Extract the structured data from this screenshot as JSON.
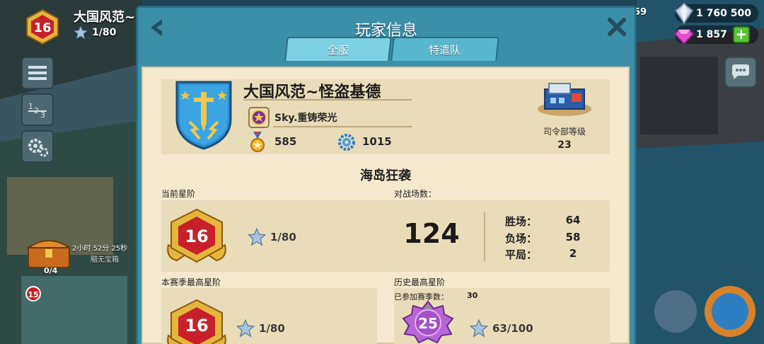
{
  "hud": {
    "player_name": "大国风范~",
    "rank_level": "16",
    "stars": "1/80",
    "partial_number": "59",
    "diamonds": "1 760 500",
    "gems": "1 857",
    "plus": "+",
    "notification_count": "15",
    "chest_timer": "2小时 52分 25秒",
    "chest_label": "黯无宝箱",
    "chest_progress": "0/4"
  },
  "modal": {
    "title": "玩家信息",
    "tabs": [
      {
        "label": "全服"
      },
      {
        "label": "特遣队"
      }
    ]
  },
  "profile": {
    "name": "大国风范~怪盗基德",
    "team": "Sky.重铸荣光",
    "medals": "585",
    "intel": "1015",
    "hq_label": "司令部等级",
    "hq_level": "23"
  },
  "warfare": {
    "section_title": "海岛狂袭",
    "current_rank_label": "当前星阶",
    "current_rank": "16",
    "current_stars": "1/80",
    "battles_label": "对战场数：",
    "battles_total": "124",
    "wins_label": "胜场：",
    "wins": "64",
    "losses_label": "负场：",
    "losses": "58",
    "draws_label": "平局：",
    "draws": "2",
    "season_best_label": "本赛季最高星阶",
    "season_best_rank": "16",
    "season_best_stars": "1/80",
    "all_time_label": "历史最高星阶",
    "seasons_played_label": "已参加赛季数：",
    "seasons_played": "30",
    "all_time_rank": "25",
    "all_time_stars": "63/100"
  },
  "colors": {
    "modal_teal": "#3c8fa8",
    "paper": "#f4e9cf",
    "panel": "#e9dcb9",
    "badge_red": "#c8202a",
    "badge_gold": "#e6b63c",
    "purple_badge": "#a54fc9"
  }
}
